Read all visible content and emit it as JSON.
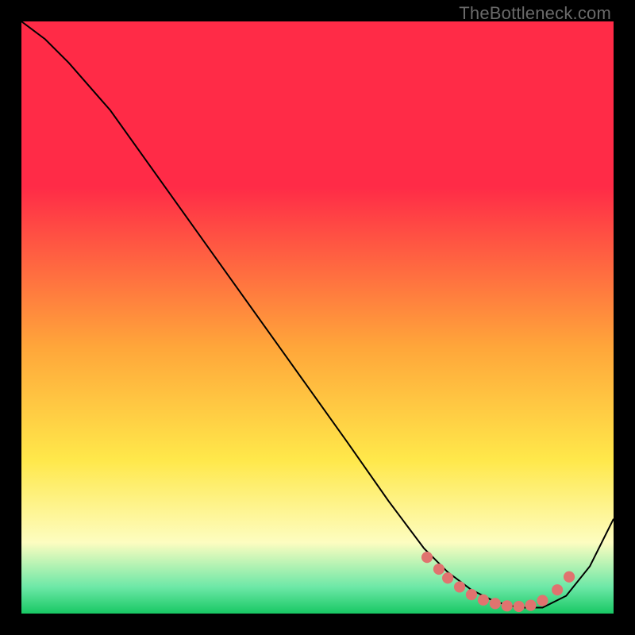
{
  "attribution": "TheBottleneck.com",
  "colors": {
    "red": "#ff2b47",
    "orange": "#ffa63a",
    "yellow": "#ffe84a",
    "paleyellow": "#fdfdc0",
    "mint": "#6de8a7",
    "green": "#18c864",
    "line": "#000000",
    "dot": "#e0736f"
  },
  "chart_data": {
    "type": "line",
    "title": "",
    "xlabel": "",
    "ylabel": "",
    "xlim": [
      0,
      100
    ],
    "ylim": [
      0,
      100
    ],
    "series": [
      {
        "name": "curve",
        "x": [
          0,
          4,
          8,
          15,
          25,
          35,
          45,
          55,
          62,
          68,
          72,
          76,
          80,
          84,
          88,
          92,
          96,
          100
        ],
        "values": [
          100,
          97,
          93,
          85,
          71,
          57,
          43,
          29,
          19,
          11,
          7,
          4,
          2,
          1,
          1,
          3,
          8,
          16
        ]
      }
    ],
    "markers": {
      "name": "floor-dots",
      "x": [
        68.5,
        70.5,
        72,
        74,
        76,
        78,
        80,
        82,
        84,
        86,
        88,
        90.5,
        92.5
      ],
      "values": [
        9.5,
        7.5,
        6,
        4.5,
        3.2,
        2.3,
        1.7,
        1.3,
        1.2,
        1.4,
        2.2,
        4.0,
        6.2
      ]
    },
    "gradient_stops": [
      {
        "offset": 0.0,
        "color_key": "red"
      },
      {
        "offset": 0.28,
        "color_key": "red"
      },
      {
        "offset": 0.55,
        "color_key": "orange"
      },
      {
        "offset": 0.74,
        "color_key": "yellow"
      },
      {
        "offset": 0.88,
        "color_key": "paleyellow"
      },
      {
        "offset": 0.955,
        "color_key": "mint"
      },
      {
        "offset": 1.0,
        "color_key": "green"
      }
    ]
  }
}
